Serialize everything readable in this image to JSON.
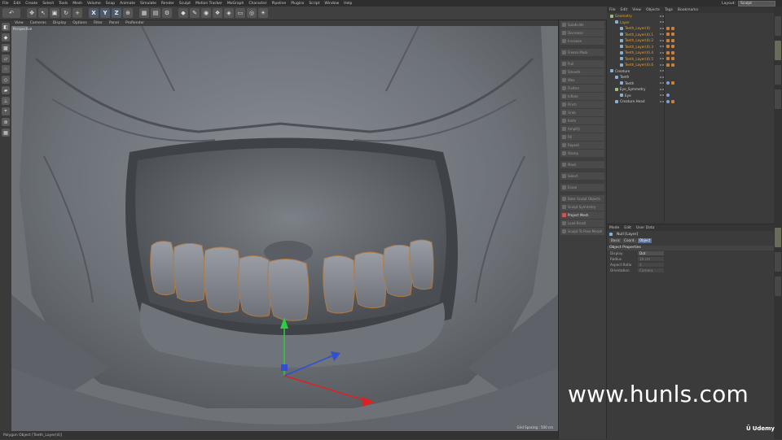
{
  "menubar": {
    "items": [
      "File",
      "Edit",
      "Create",
      "Select",
      "Tools",
      "Mesh",
      "Volume",
      "Snap",
      "Animate",
      "Simulate",
      "Render",
      "Sculpt",
      "Motion Tracker",
      "MoGraph",
      "Character",
      "Pipeline",
      "Plugins",
      "Script",
      "Window",
      "Help"
    ],
    "layout_label": "Layout:",
    "layout_value": "Sculpt"
  },
  "viewport": {
    "menu": [
      "View",
      "Cameras",
      "Display",
      "Options",
      "Filter",
      "Panel",
      "ProRender"
    ],
    "camera_label": "Perspective",
    "grid_spacing": "Grid Spacing : 500 cm"
  },
  "status_bar": {
    "text": "Polygon Object [Teeth_Layer(4)]"
  },
  "sculpt_tools": {
    "items": [
      {
        "label": "Subdivide",
        "state": "dim"
      },
      {
        "label": "Decrease",
        "state": "dim"
      },
      {
        "label": "Increase",
        "state": "dim"
      },
      {
        "label": "Freeze Mask",
        "state": "dim"
      },
      {
        "label": "Pull",
        "state": "dim"
      },
      {
        "label": "Smooth",
        "state": "dim"
      },
      {
        "label": "Wax",
        "state": "dim"
      },
      {
        "label": "Flatten",
        "state": "dim"
      },
      {
        "label": "Inflate",
        "state": "dim"
      },
      {
        "label": "Pinch",
        "state": "dim"
      },
      {
        "label": "Grab",
        "state": "dim"
      },
      {
        "label": "Knife",
        "state": "dim"
      },
      {
        "label": "Amplify",
        "state": "dim"
      },
      {
        "label": "Fill",
        "state": "dim"
      },
      {
        "label": "Repeat",
        "state": "dim"
      },
      {
        "label": "Stamp",
        "state": "dim"
      },
      {
        "label": "Mask",
        "state": "dim"
      },
      {
        "label": "Select",
        "state": "dim"
      },
      {
        "label": "Erase",
        "state": "dim"
      },
      {
        "label": "Bake Sculpt Objects",
        "state": "dim"
      },
      {
        "label": "Sculpt Symmetry",
        "state": "dim"
      },
      {
        "label": "Project Mesh",
        "state": "active"
      },
      {
        "label": "Load Brush",
        "state": "dim"
      },
      {
        "label": "Sculpt To Pose Morph",
        "state": "dim"
      }
    ]
  },
  "object_manager": {
    "menu": [
      "File",
      "Edit",
      "View",
      "Objects",
      "Tags",
      "Bookmarks"
    ],
    "rows": [
      {
        "name": "Geometry",
        "indent": 0,
        "color": "orange"
      },
      {
        "name": "Layer",
        "indent": 1,
        "color": "orange"
      },
      {
        "name": "Teeth_Layer(4)",
        "indent": 2,
        "color": "orange"
      },
      {
        "name": "Teeth_Layer(4).1",
        "indent": 2,
        "color": "orange"
      },
      {
        "name": "Teeth_Layer(4).2",
        "indent": 2,
        "color": "orange"
      },
      {
        "name": "Teeth_Layer(4).3",
        "indent": 2,
        "color": "orange"
      },
      {
        "name": "Teeth_Layer(4).4",
        "indent": 2,
        "color": "orange"
      },
      {
        "name": "Teeth_Layer(4).5",
        "indent": 2,
        "color": "orange"
      },
      {
        "name": "Teeth_Layer(4).6",
        "indent": 2,
        "color": "orange"
      },
      {
        "name": "Creature",
        "indent": 0,
        "color": "white"
      },
      {
        "name": "Teeth",
        "indent": 1,
        "color": "white"
      },
      {
        "name": "Teeth",
        "indent": 2,
        "color": "white"
      },
      {
        "name": "Eye_Symmetry",
        "indent": 1,
        "color": "white"
      },
      {
        "name": "Eye",
        "indent": 2,
        "color": "white"
      },
      {
        "name": "Creature Head",
        "indent": 1,
        "color": "white"
      }
    ]
  },
  "attribute_manager": {
    "menu": [
      "Mode",
      "Edit",
      "User Data"
    ],
    "title": "Null [Layer]",
    "tabs": [
      "Basic",
      "Coord.",
      "Object"
    ],
    "active_tab": "Object",
    "section": "Object Properties",
    "props": [
      {
        "label": "Display",
        "value": "Dot",
        "dim": false
      },
      {
        "label": "Radius",
        "value": "10 cm",
        "dim": true
      },
      {
        "label": "Aspect Ratio",
        "value": "1",
        "dim": true
      },
      {
        "label": "Orientation",
        "value": "Camera",
        "dim": true
      }
    ]
  },
  "watermark": "www.hunls.com",
  "brand": "Udemy",
  "colors": {
    "accent_orange": "#e8a03a",
    "active_tab": "#5a6e9a",
    "axis_y": "#2ecc40",
    "axis_x": "#e02020",
    "axis_z": "#3050d0"
  }
}
